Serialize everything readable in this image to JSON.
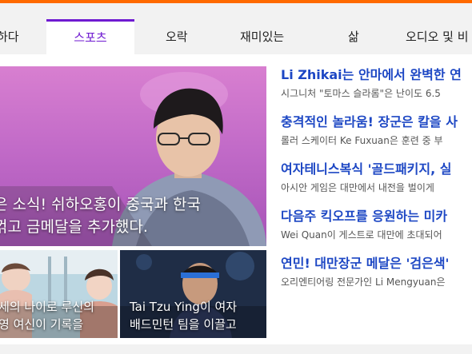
{
  "tabs": [
    {
      "label": "하다"
    },
    {
      "label": "스포츠"
    },
    {
      "label": "오락"
    },
    {
      "label": "재미있는"
    },
    {
      "label": "삶"
    },
    {
      "label": "오디오 및 비"
    }
  ],
  "hero": {
    "caption_line1": "은 소식! 쉬하오홍이 중국과 한국",
    "caption_line2": "꺾고 금메달을 추가했다."
  },
  "thumbs": [
    {
      "caption_line1": "세의 나이로 루신의",
      "caption_line2": "영 여신이 기록을"
    },
    {
      "caption_line1": "Tai Tzu Ying이 여자",
      "caption_line2": "배드민턴 팀을 이끌고"
    }
  ],
  "news": [
    {
      "headline": "Li Zhikai는 안마에서 완벽한 연",
      "summary": "시그니처 \"토마스 슬라롬\"은 난이도 6.5"
    },
    {
      "headline": "충격적인 놀라움! 장군은 칼을 사",
      "summary": "롤러 스케이터 Ke Fuxuan은 훈련 중 부"
    },
    {
      "headline": "여자테니스복식 '골드패키지, 실",
      "summary": "아시안 게임은 대만에서 내전을 벌이게"
    },
    {
      "headline": "다음주 킥오프를 응원하는 미카",
      "summary": "Wei Quan이 게스트로 대만에 초대되어"
    },
    {
      "headline": "연민! 대만장군 메달은 '검은색'",
      "summary": "오리엔티어링 전문가인 Li Mengyuan은"
    }
  ]
}
